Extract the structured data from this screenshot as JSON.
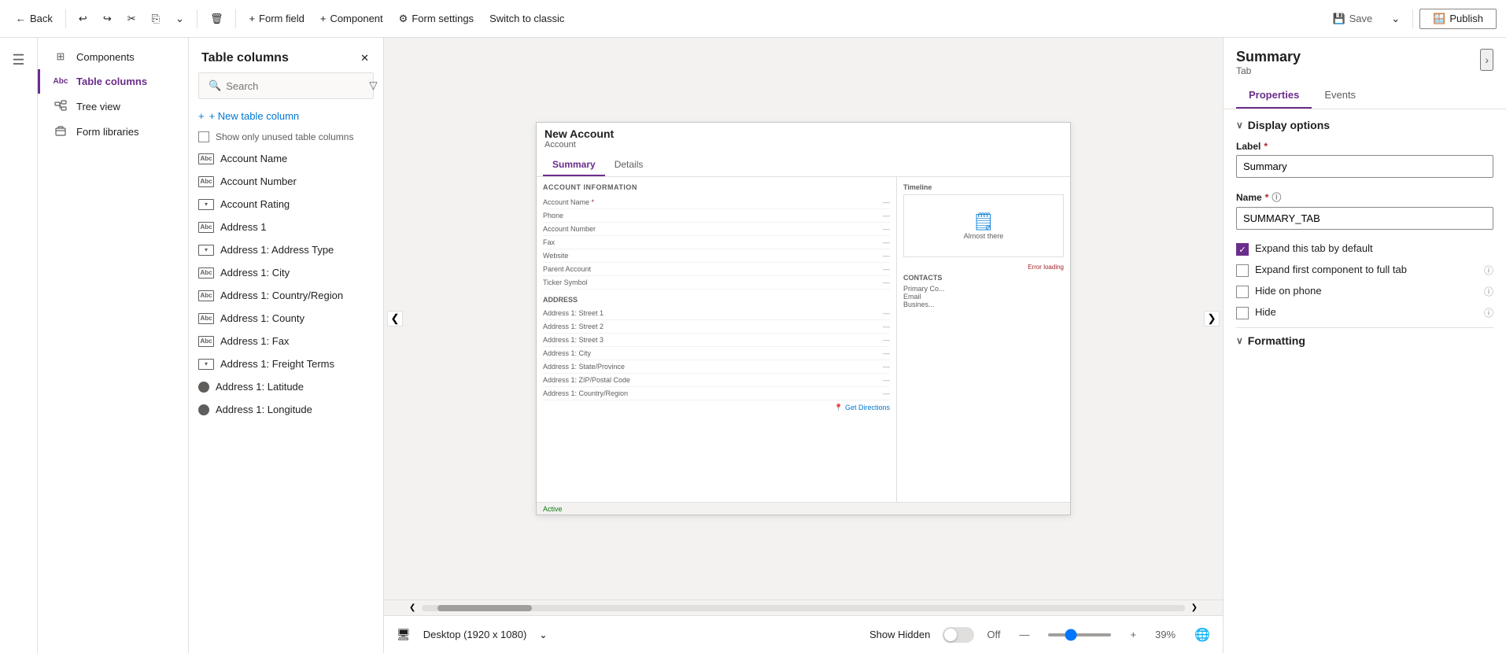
{
  "toolbar": {
    "back_label": "Back",
    "form_field_label": "Form field",
    "component_label": "Component",
    "form_settings_label": "Form settings",
    "switch_classic_label": "Switch to classic",
    "save_label": "Save",
    "publish_label": "Publish"
  },
  "sidebar_icons": {
    "hamburger": "☰"
  },
  "nav_sidebar": {
    "items": [
      {
        "label": "Components",
        "icon": "⊞"
      },
      {
        "label": "Table columns",
        "icon": "Abc",
        "active": true
      },
      {
        "label": "Tree view",
        "icon": "🌳"
      },
      {
        "label": "Form libraries",
        "icon": "📚"
      }
    ]
  },
  "left_panel": {
    "title": "Table columns",
    "search_placeholder": "Search",
    "new_column_label": "+ New table column",
    "show_unused_label": "Show only unused table columns",
    "items": [
      {
        "label": "Account Name",
        "type": "text"
      },
      {
        "label": "Account Number",
        "type": "text"
      },
      {
        "label": "Account Rating",
        "type": "dropdown"
      },
      {
        "label": "Address 1",
        "type": "text"
      },
      {
        "label": "Address 1: Address Type",
        "type": "dropdown"
      },
      {
        "label": "Address 1: City",
        "type": "text"
      },
      {
        "label": "Address 1: Country/Region",
        "type": "text"
      },
      {
        "label": "Address 1: County",
        "type": "text"
      },
      {
        "label": "Address 1: Fax",
        "type": "text"
      },
      {
        "label": "Address 1: Freight Terms",
        "type": "dropdown"
      },
      {
        "label": "Address 1: Latitude",
        "type": "circle"
      },
      {
        "label": "Address 1: Longitude",
        "type": "circle"
      }
    ]
  },
  "form_preview": {
    "title": "New Account",
    "subtitle": "Account",
    "tabs": [
      "Summary",
      "Details"
    ],
    "active_tab": "Summary",
    "account_section_title": "ACCOUNT INFORMATION",
    "account_fields": [
      {
        "label": "Account Name",
        "required": true
      },
      {
        "label": "Phone"
      },
      {
        "label": "Account Number"
      },
      {
        "label": "Fax"
      },
      {
        "label": "Website"
      },
      {
        "label": "Parent Account"
      },
      {
        "label": "Ticker Symbol"
      }
    ],
    "timeline_label": "Timeline",
    "timeline_icon": "🗒",
    "timeline_almost_there": "Almost there",
    "error_loading": "Error loading",
    "address_section_title": "ADDRESS",
    "address_fields": [
      {
        "label": "Address 1: Street 1"
      },
      {
        "label": "Address 1: Street 2"
      },
      {
        "label": "Address 1: Street 3"
      },
      {
        "label": "Address 1: City"
      },
      {
        "label": "Address 1: State/Province"
      },
      {
        "label": "Address 1: ZIP/Postal Code"
      },
      {
        "label": "Address 1: Country/Region"
      }
    ],
    "get_directions": "Get Directions",
    "contacts_label": "CONTACTS",
    "status": "Active",
    "primary_contact": "Primary Co...",
    "email_label": "Email",
    "business_label": "Busines..."
  },
  "right_panel": {
    "title": "Summary",
    "subtitle": "Tab",
    "nav_items": [
      "Properties",
      "Events"
    ],
    "active_nav": "Properties",
    "display_options_label": "Display options",
    "label_field": {
      "label": "Label",
      "value": "Summary"
    },
    "name_field": {
      "label": "Name",
      "value": "SUMMARY_TAB"
    },
    "expand_tab_label": "Expand this tab by default",
    "expand_tab_checked": true,
    "expand_first_label": "Expand first component to full tab",
    "expand_first_checked": false,
    "hide_phone_label": "Hide on phone",
    "hide_phone_checked": false,
    "hide_label": "Hide",
    "hide_checked": false,
    "formatting_label": "Formatting"
  },
  "bottom_bar": {
    "device_label": "Desktop (1920 x 1080)",
    "show_hidden_label": "Show Hidden",
    "toggle_state": "Off",
    "zoom_percent": "39%",
    "zoom_minus": "—",
    "zoom_plus": "+"
  },
  "icons": {
    "back_arrow": "←",
    "undo": "↩",
    "redo": "↪",
    "scissors": "✂",
    "copy": "⎘",
    "dropdown_arrow": "⌄",
    "trash": "🗑",
    "plus": "+",
    "settings": "⚙",
    "save": "💾",
    "publish_window": "🪟",
    "dropdown_sm": "▾",
    "chevron_right": "›",
    "chevron_down": "∨",
    "close": "✕",
    "search_icon": "🔍",
    "filter_icon": "▽",
    "info_icon": "ⓘ",
    "checkbox_checked": "✓",
    "scroll_left": "❮",
    "scroll_right": "❯",
    "globe": "🌐",
    "monitor": "🖥",
    "chevron_down_sm": "⌄"
  }
}
